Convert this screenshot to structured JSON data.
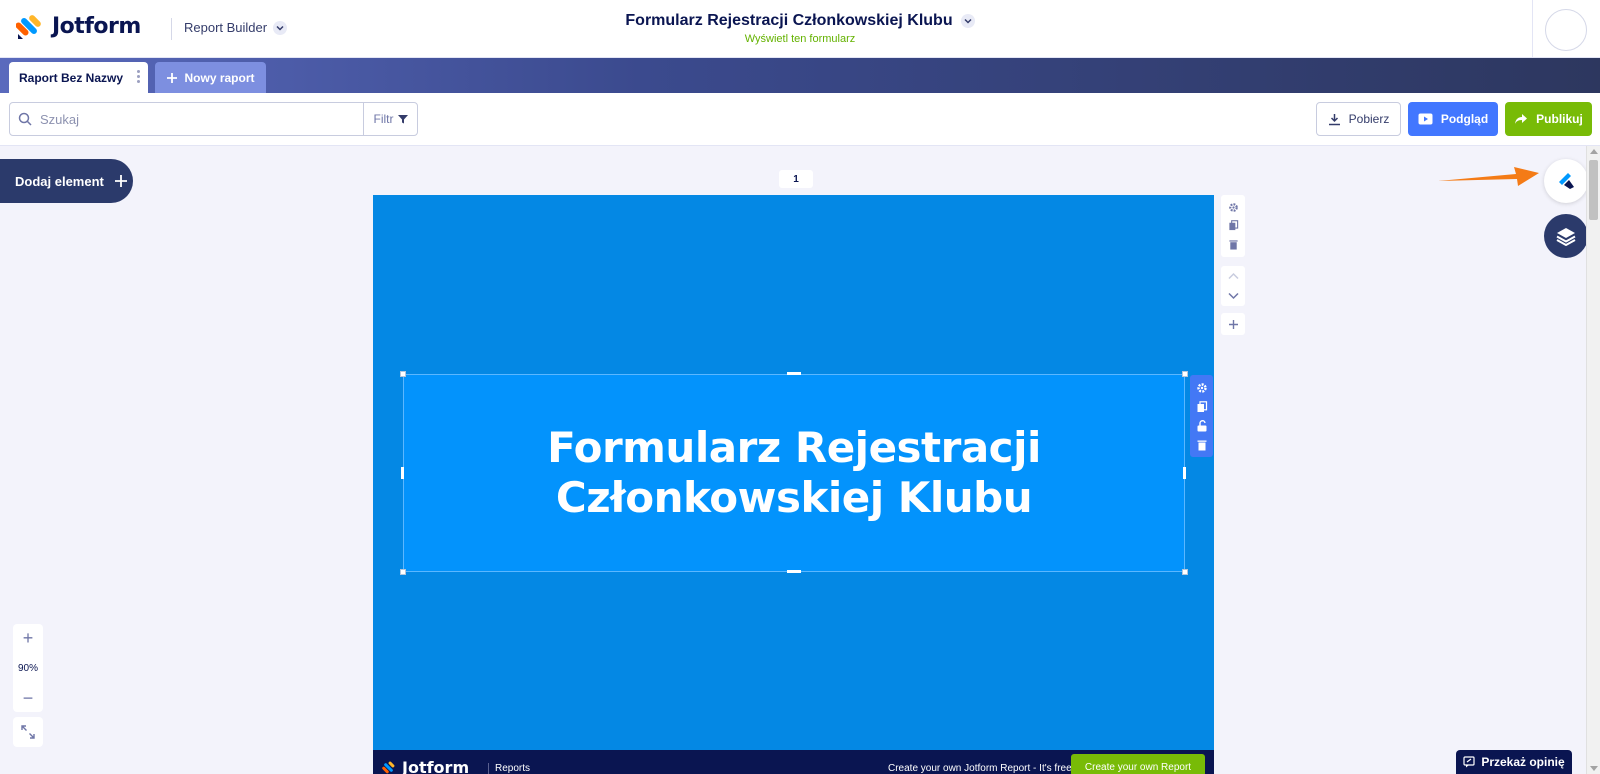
{
  "header": {
    "brand": "Jotform",
    "product": "Report Builder",
    "form_title": "Formularz Rejestracji Członkowskiej Klubu",
    "view_form_link": "Wyświetl ten formularz"
  },
  "tabs": {
    "active_label": "Raport Bez Nazwy",
    "new_label": "Nowy raport"
  },
  "toolbar": {
    "search_placeholder": "Szukaj",
    "filter_label": "Filtr",
    "download_label": "Pobierz",
    "preview_label": "Podgląd",
    "publish_label": "Publikuj"
  },
  "canvas": {
    "add_element_label": "Dodaj element",
    "page_number": "1",
    "zoom_level": "90%",
    "title_element_text": "Formularz Rejestracji Członkowskiej Klubu",
    "footer_brand": "Jotform",
    "footer_reports": "Reports",
    "footer_cta_text": "Create your own Jotform Report - It's free",
    "footer_cta_button": "Create your own Report",
    "feedback_label": "Przekaż opinię"
  },
  "colors": {
    "page_background": "#0488e4",
    "title_background": "#0393fc",
    "preview_button": "#4277ff",
    "publish_button": "#78bb07",
    "navy": "#0a1551"
  },
  "icons": {
    "design": "paint-brush-icon",
    "layers": "layers-icon",
    "settings": "gear-icon",
    "duplicate": "copy-icon",
    "delete": "trash-icon",
    "lock": "unlock-icon"
  }
}
